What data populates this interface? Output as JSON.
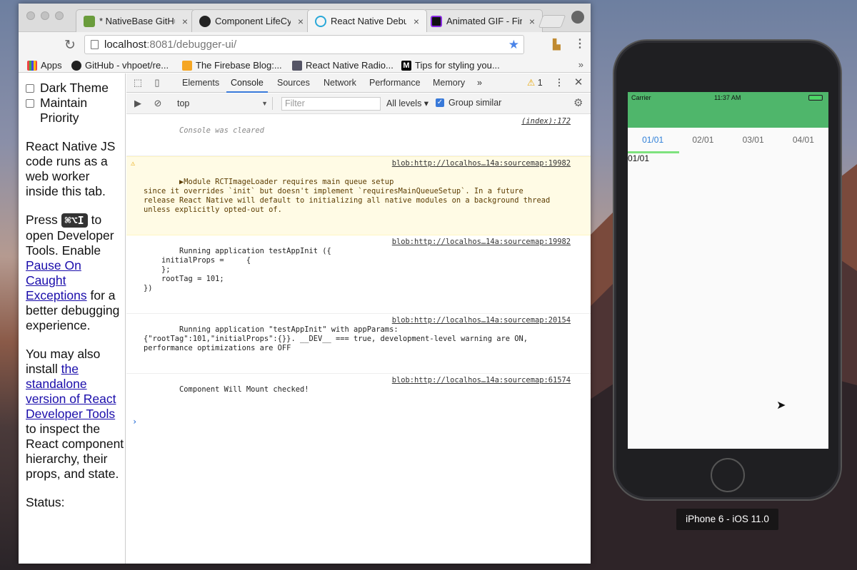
{
  "tabs": [
    {
      "title": "* NativeBase GitHu",
      "favicon": "nativebase-icon",
      "color": "#6a9c3c"
    },
    {
      "title": "Component LifeCyc",
      "favicon": "github-icon",
      "color": "#222222"
    },
    {
      "title": "React Native Debu",
      "favicon": "react-icon",
      "color": "#29a8d8",
      "active": true
    },
    {
      "title": "Animated GIF - Fin",
      "favicon": "giphy-icon",
      "color": "#8a2be2"
    }
  ],
  "address": {
    "host": "localhost",
    "rest": ":8081/debugger-ui/"
  },
  "bookmarks": [
    {
      "label": "Apps",
      "icon": "apps-icon"
    },
    {
      "label": "GitHub - vhpoet/re...",
      "icon": "github-icon"
    },
    {
      "label": "The Firebase Blog:...",
      "icon": "firebase-icon"
    },
    {
      "label": "React Native Radio...",
      "icon": "radio-icon"
    },
    {
      "label": "Tips for styling you...",
      "icon": "medium-icon"
    }
  ],
  "left": {
    "dark_theme": "Dark Theme",
    "maintain_priority": "Maintain Priority",
    "p1": "React Native JS code runs as a web worker inside this tab.",
    "press": "Press",
    "kbd": "⌘⌥I",
    "p2a": "to open Developer Tools. Enable",
    "p2link": "Pause On Caught Exceptions",
    "p2b": "for a better debugging experience.",
    "p3a": "You may also install",
    "p3link": "the standalone version of React Developer Tools",
    "p3b": "to inspect the React component hierarchy, their props, and state.",
    "status": "Status:"
  },
  "devtools": {
    "tabs": [
      "Elements",
      "Console",
      "Sources",
      "Network",
      "Performance",
      "Memory"
    ],
    "active_tab": "Console",
    "more": "»",
    "warn_count": "1",
    "context": "top",
    "filter_placeholder": "Filter",
    "levels": "All levels ▾",
    "group_similar": "Group similar"
  },
  "console": {
    "messages": [
      {
        "kind": "cleared",
        "text": "Console was cleared",
        "src": "(index):172"
      },
      {
        "kind": "warn",
        "text": "▶Module RCTImageLoader requires main queue setup\nsince it overrides `init` but doesn't implement `requiresMainQueueSetup`. In a future\nrelease React Native will default to initializing all native modules on a background thread\nunless explicitly opted-out of.",
        "src": "blob:http://localhos…14a:sourcemap:19982"
      },
      {
        "kind": "log",
        "text": "Running application testAppInit ({\n    initialProps =     {\n    };\n    rootTag = 101;\n})",
        "src": "blob:http://localhos…14a:sourcemap:19982"
      },
      {
        "kind": "log",
        "text": "Running application \"testAppInit\" with appParams:\n{\"rootTag\":101,\"initialProps\":{}}. __DEV__ === true, development-level warning are ON,\nperformance optimizations are OFF",
        "src": "blob:http://localhos…14a:sourcemap:20154"
      },
      {
        "kind": "log",
        "text": "Component Will Mount checked!",
        "src": "blob:http://localhos…14a:sourcemap:61574"
      }
    ],
    "prompt": "›"
  },
  "simulator": {
    "carrier": "Carrier",
    "time": "11:37 AM",
    "tabs": [
      "01/01",
      "02/01",
      "03/01",
      "04/01"
    ],
    "active_tab": "01/01",
    "content": "01/01",
    "label": "iPhone 6 - iOS 11.0",
    "header_color": "#4fb66b"
  }
}
